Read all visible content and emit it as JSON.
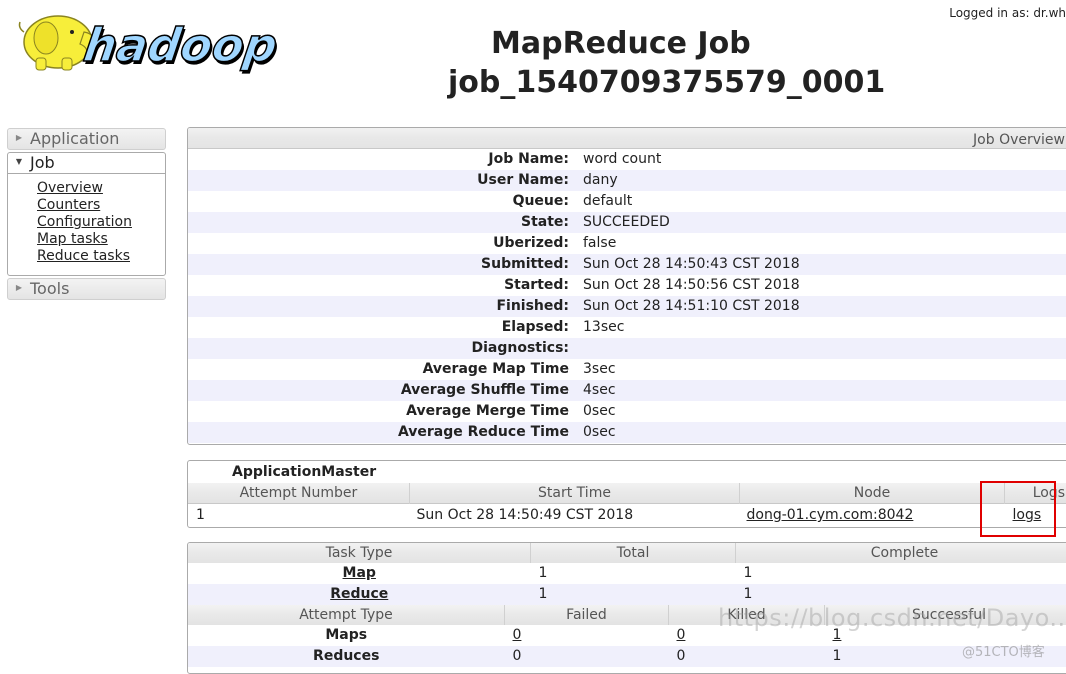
{
  "header": {
    "logo_text": "hadoop",
    "logged_in": "Logged in as: dr.wh",
    "title_line1": "MapReduce Job",
    "title_line2": "job_1540709375579_0001"
  },
  "sidebar": {
    "application_label": "Application",
    "job_label": "Job",
    "job_links": [
      "Overview",
      "Counters",
      "Configuration",
      "Map tasks",
      "Reduce tasks"
    ],
    "tools_label": "Tools"
  },
  "overview": {
    "heading": "Job Overview",
    "rows": [
      {
        "label": "Job Name:",
        "value": "word count"
      },
      {
        "label": "User Name:",
        "value": "dany"
      },
      {
        "label": "Queue:",
        "value": "default"
      },
      {
        "label": "State:",
        "value": "SUCCEEDED"
      },
      {
        "label": "Uberized:",
        "value": "false"
      },
      {
        "label": "Submitted:",
        "value": "Sun Oct 28 14:50:43 CST 2018"
      },
      {
        "label": "Started:",
        "value": "Sun Oct 28 14:50:56 CST 2018"
      },
      {
        "label": "Finished:",
        "value": "Sun Oct 28 14:51:10 CST 2018"
      },
      {
        "label": "Elapsed:",
        "value": "13sec"
      },
      {
        "label": "Diagnostics:",
        "value": ""
      },
      {
        "label": "Average Map Time",
        "value": "3sec"
      },
      {
        "label": "Average Shuffle Time",
        "value": "4sec"
      },
      {
        "label": "Average Merge Time",
        "value": "0sec"
      },
      {
        "label": "Average Reduce Time",
        "value": "0sec"
      }
    ]
  },
  "application_master": {
    "title": "ApplicationMaster",
    "columns": [
      "Attempt Number",
      "Start Time",
      "Node",
      "Logs"
    ],
    "rows": [
      {
        "attempt": "1",
        "start_time": "Sun Oct 28 14:50:49 CST 2018",
        "node": "dong-01.cym.com:8042",
        "logs": "logs"
      }
    ]
  },
  "tasks": {
    "task_columns": [
      "Task Type",
      "Total",
      "Complete"
    ],
    "task_rows": [
      {
        "type": "Map",
        "total": "1",
        "complete": "1"
      },
      {
        "type": "Reduce",
        "total": "1",
        "complete": "1"
      }
    ],
    "attempt_columns": [
      "Attempt Type",
      "Failed",
      "Killed",
      "Successful"
    ],
    "attempt_rows": [
      {
        "type": "Maps",
        "failed": "0",
        "killed": "0",
        "successful": "1"
      },
      {
        "type": "Reduces",
        "failed": "0",
        "killed": "0",
        "successful": "1"
      }
    ]
  },
  "watermark": {
    "url_text": "https://blog.csdn.net/Dayo...",
    "site_text": "@51CTO博客"
  }
}
